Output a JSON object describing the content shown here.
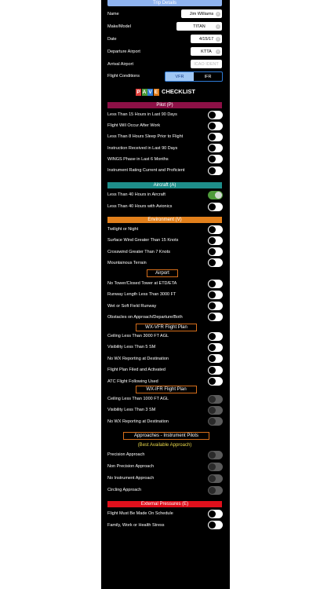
{
  "trip": {
    "header": "Trip Details",
    "name_label": "Name",
    "name_value": "Jim Williams",
    "make_label": "Make/Model",
    "make_value": "TITAN",
    "date_label": "Date",
    "date_value": "4/15/17",
    "dep_label": "Departure Airport",
    "dep_value": "KTTA",
    "arr_label": "Arrival Airport",
    "arr_placeholder": "ICAO IDENT",
    "cond_label": "Flight Conditions",
    "vfr": "VFR",
    "ifr": "IFR"
  },
  "title": {
    "letters": [
      "P",
      "A",
      "V",
      "E"
    ],
    "letter_colors": [
      "#e0403c",
      "#4e9a3a",
      "#2f7bd6",
      "#e07b1a"
    ],
    "rest": "CHECKLIST"
  },
  "pilot": {
    "header": "Pilot (P)",
    "color": "#8c1046",
    "items": [
      {
        "label": "Less Than 15 Hours in Last 90 Days",
        "state": "off"
      },
      {
        "label": "Flight Will Occur After Work",
        "state": "off"
      },
      {
        "label": "Less Than 8 Hours Sleep Prior to Flight",
        "state": "off"
      },
      {
        "label": "Instruction Received in Last 90 Days",
        "state": "off"
      },
      {
        "label": "WINGS Phase in Last 6 Months",
        "state": "off"
      },
      {
        "label": "Instrument Rating Current and Proficient",
        "state": "off"
      }
    ]
  },
  "aircraft": {
    "header": "Aircraft (A)",
    "color": "#1e8e8a",
    "items": [
      {
        "label": "Less Than 40 Hours in Aircraft",
        "state": "on"
      },
      {
        "label": "Less Than 40 Hours with Avionics",
        "state": "off"
      }
    ]
  },
  "environment": {
    "header": "Environment (V)",
    "color": "#e2801c",
    "items": [
      {
        "label": "Twilight or Night",
        "state": "off"
      },
      {
        "label": "Surface Wind Greater Than 15 Knots",
        "state": "off"
      },
      {
        "label": "Crosswind Greater Than 7 Knots",
        "state": "off"
      },
      {
        "label": "Mountainous Terrain",
        "state": "off"
      }
    ]
  },
  "airport": {
    "header": "Airport",
    "items": [
      {
        "label": "No Tower/Closed Tower at ETD/ETA",
        "state": "off"
      },
      {
        "label": "Runway Length Less Than 3000 FT",
        "state": "off"
      },
      {
        "label": "Wet or Soft Field Runway",
        "state": "off"
      },
      {
        "label": "Obstacles on Approach/Departure/Both",
        "state": "off"
      }
    ]
  },
  "wxvfr": {
    "header": "WX-VFR Flight Plan",
    "items": [
      {
        "label": "Ceiling Less Than 3000 FT AGL",
        "state": "off"
      },
      {
        "label": "Visibility Less Than 5 SM",
        "state": "off"
      },
      {
        "label": "No WX Reporting at Destination",
        "state": "off"
      },
      {
        "label": "Flight Plan Filed and Activated",
        "state": "off"
      },
      {
        "label": "ATC Flight Following Used",
        "state": "off"
      }
    ]
  },
  "wxifr": {
    "header": "WX-IFR Flight Plan",
    "items": [
      {
        "label": "Ceiling Less Than 1000 FT AGL",
        "state": "disabled"
      },
      {
        "label": "Visibility Less Than 3 SM",
        "state": "disabled"
      },
      {
        "label": "No WX Reporting at Destination",
        "state": "disabled"
      }
    ]
  },
  "approaches": {
    "header": "Approaches - Instrument Pilots",
    "note": "(Best Available Approach)",
    "note_color": "#e8d84a",
    "items": [
      {
        "label": "Precision Approach",
        "state": "disabled"
      },
      {
        "label": "Non Precision Approach",
        "state": "disabled"
      },
      {
        "label": "No Instrument Approach",
        "state": "disabled"
      },
      {
        "label": "Circling Approach",
        "state": "disabled"
      }
    ]
  },
  "external": {
    "header": "External Pressures (E)",
    "color": "#e0101c",
    "items": [
      {
        "label": "Flight Must Be Made On Schedule",
        "state": "off"
      },
      {
        "label": "Family, Work or Health Stress",
        "state": "off"
      }
    ]
  }
}
